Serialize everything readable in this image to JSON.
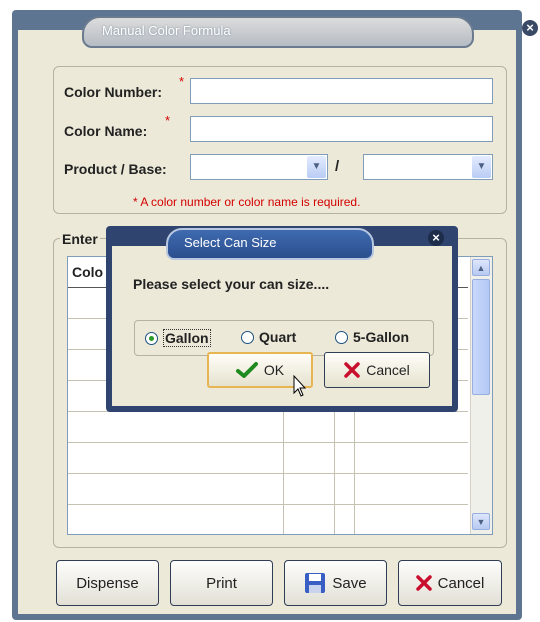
{
  "window": {
    "title": "Manual Color Formula"
  },
  "form": {
    "color_number_label": "Color Number:",
    "color_name_label": "Color Name:",
    "product_base_label": "Product / Base:",
    "required_marker": "*",
    "separator": "/",
    "required_note": "* A color number or color name is required.",
    "color_number_value": "",
    "color_name_value": "",
    "product_value": "",
    "base_value": ""
  },
  "grid": {
    "group_label": "Enter",
    "first_header": "Colo"
  },
  "buttons": {
    "dispense": "Dispense",
    "print": "Print",
    "save": "Save",
    "cancel": "Cancel"
  },
  "dialog": {
    "title": "Select Can Size",
    "prompt": "Please select your can size....",
    "options": [
      "Gallon",
      "Quart",
      "5-Gallon"
    ],
    "selected": "Gallon",
    "ok_label": "OK",
    "cancel_label": "Cancel"
  },
  "colors": {
    "accent_red": "#d40000",
    "frame": "#5e7591",
    "dialog_frame": "#2f456f"
  }
}
